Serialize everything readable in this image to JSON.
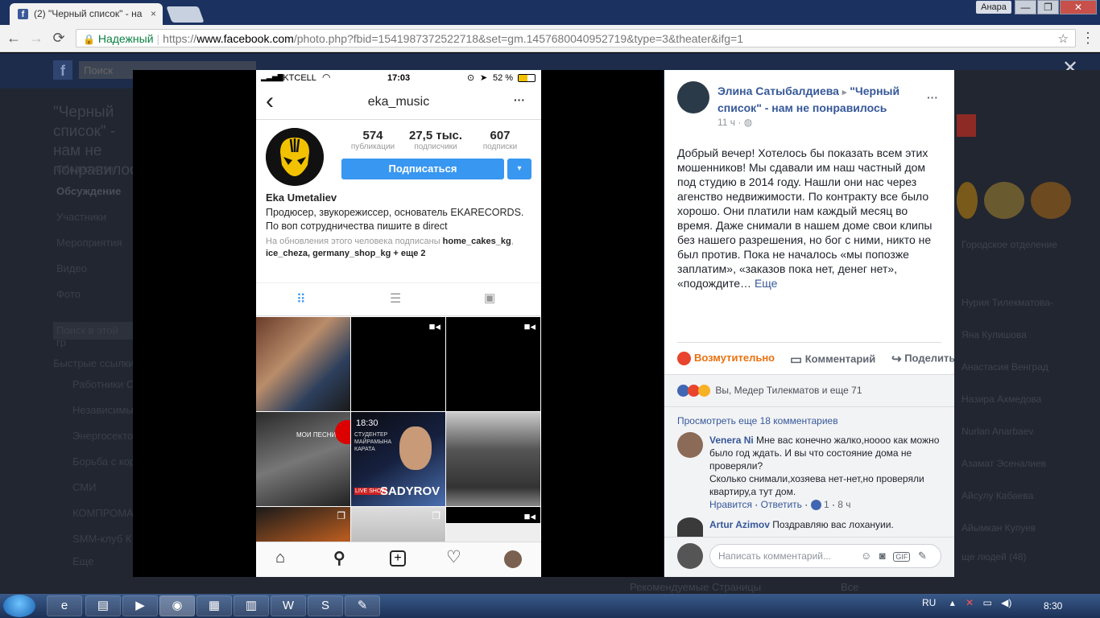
{
  "browser": {
    "tab_title": "(2) \"Черный список\" - на",
    "tab_favicon": "f",
    "tab_close": "×",
    "user_badge": "Анара",
    "minimize": "—",
    "maximize": "❐",
    "close": "✕",
    "back_icon": "←",
    "forward_icon": "→",
    "reload_icon": "⟳",
    "lock_icon": "🔒",
    "secure_label": "Надежный",
    "url_scheme": "https://",
    "url_host": "www.facebook.com",
    "url_path": "/photo.php?fbid=1541987372522718&set=gm.1457680040952719&type=3&theater&ifg=1",
    "star_icon": "☆",
    "menu_icon": "⋮"
  },
  "fb_background": {
    "search_placeholder": "Поиск",
    "group_title": "\"Черный список\" - нам не понравилось",
    "group_meta": "Обвдегоступ",
    "nav": [
      "Обсуждение",
      "Участники",
      "Мероприятия",
      "Видео",
      "Фото"
    ],
    "search_group": "Поиск в этой гр",
    "quick_links": "Быстрые ссылки",
    "shortcuts": [
      "Работники С",
      "Независимы",
      "Энергосекто",
      "Борьба с кор",
      "СМИ",
      "КОМПРОМА",
      "SMM-клуб К",
      "Еще"
    ],
    "right_names": [
      "Городское отделение",
      "Нурия Тилекматова-",
      "Яна Кулишова",
      "Анастасия Венград",
      "Назира Ахмедова",
      "Nurlan Anarbaev",
      "Азамат Эсеналиев",
      "Айсулу Кабаева",
      "Айымкан Купуев"
    ],
    "right_more": "ще людей (48)",
    "bottom_left": "Рекомендуемые Страницы",
    "bottom_right": "Все",
    "close_viewer": "✕"
  },
  "instagram": {
    "carrier": "KKTCELL",
    "time": "17:03",
    "battery": "52 %",
    "back_icon": "‹",
    "username": "eka_music",
    "more_icon": "···",
    "stats": [
      {
        "num": "574",
        "label": "публикации"
      },
      {
        "num": "27,5 тыс.",
        "label": "подписчики"
      },
      {
        "num": "607",
        "label": "подписки"
      }
    ],
    "follow_button": "Подписаться",
    "follow_dropdown": "▾",
    "name": "Eka Umetaliev",
    "bio": "Продюсер, звукорежиссер, основатель EKARECORDS. По воп сотрудничества пишите в direct",
    "followed_prefix": "На обновления этого человека подписаны",
    "followed_names": "home_cakes_kg",
    "followed_line2_names": "ice_cheza, germany_shop_kg",
    "followed_more": " + еще 2",
    "grid_texts": {
      "poster_overlay": "МОИ ПЕСНИ",
      "poster_2": "18:30",
      "poster_3": "СТУДЕНТЕР МАЙРАМЫНА КАРАТА",
      "poster_4": "LIVE SHOW",
      "poster_5": "SADYROV"
    }
  },
  "post": {
    "author": "Элина Сатыбалдиева",
    "arrow": "▸",
    "group": "\"Черный список\" - нам не понравилось",
    "time": "11 ч",
    "privacy_icon": "globe-icon",
    "more_icon": "···",
    "body": "Добрый вечер! Хотелось бы показать всем этих мошенников! Мы сдавали им наш частный дом под студию в 2014 году. Нашли они нас через агенство недвижимости. По контракту все было хорошо. Они платили нам каждый месяц во время. Даже снимали в нашем доме свои клипы без нашего разрешения, но бог с ними, никто не был против. Пока не началось «мы попозже заплатим», «заказов пока нет, денег нет», «подождите…",
    "more_link": "Еще",
    "actions": {
      "react": "Возмутительно",
      "comment": "Комментарий",
      "share": "Поделиться"
    },
    "reactions_text": "Вы, Медер Тилекматов и еще 71",
    "view_more": "Просмотреть еще 18 комментариев",
    "comments": [
      {
        "author": "Venera Ni",
        "text1": "Мне вас конечно жалко,нoooo как можно было год ждать. И вы что состояние дома не проверяли?",
        "text2": "Сколько снимали,хозяева нет-нет,но проверяли квартиру,а тут дом.",
        "like": "Нравится",
        "reply": "Ответить",
        "likes": "1",
        "time": "8 ч"
      },
      {
        "author": "Artur Azimov",
        "text1": "Поздравляю вас лохануии."
      }
    ],
    "comment_placeholder": "Написать комментарий..."
  },
  "taskbar": {
    "lang": "RU",
    "time": "8:30"
  }
}
